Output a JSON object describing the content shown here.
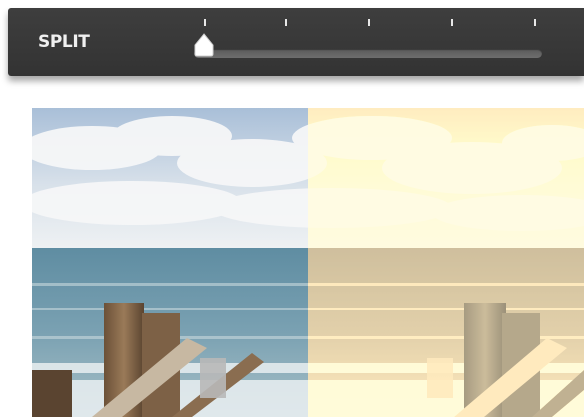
{
  "toolbar": {
    "label": "SPLIT"
  },
  "slider": {
    "value": 0,
    "tick_count": 5,
    "thumb_color": "#ffffff",
    "track_color": "#666666"
  },
  "preview": {
    "split_position": 0.5,
    "left_treatment": "original",
    "right_treatment": "sepia"
  }
}
